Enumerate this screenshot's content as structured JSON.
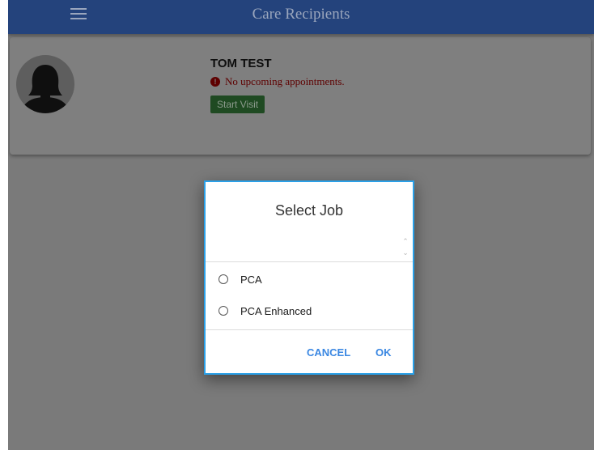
{
  "header": {
    "title": "Care Recipients",
    "menu_icon": "hamburger-menu-icon"
  },
  "recipient": {
    "name": "TOM TEST",
    "appointment_status": "No upcoming appointments.",
    "start_visit_label": "Start Visit",
    "avatar_icon": "person-avatar-icon"
  },
  "dialog": {
    "title": "Select Job",
    "options": [
      {
        "label": "PCA",
        "selected": false
      },
      {
        "label": "PCA Enhanced",
        "selected": false
      }
    ],
    "cancel_label": "CANCEL",
    "ok_label": "OK"
  },
  "colors": {
    "header_bg": "#24437c",
    "accent": "#3a87e2",
    "dialog_border": "#2aa0e8",
    "alert": "#5e0000",
    "start_visit_bg": "#1f4a22"
  }
}
